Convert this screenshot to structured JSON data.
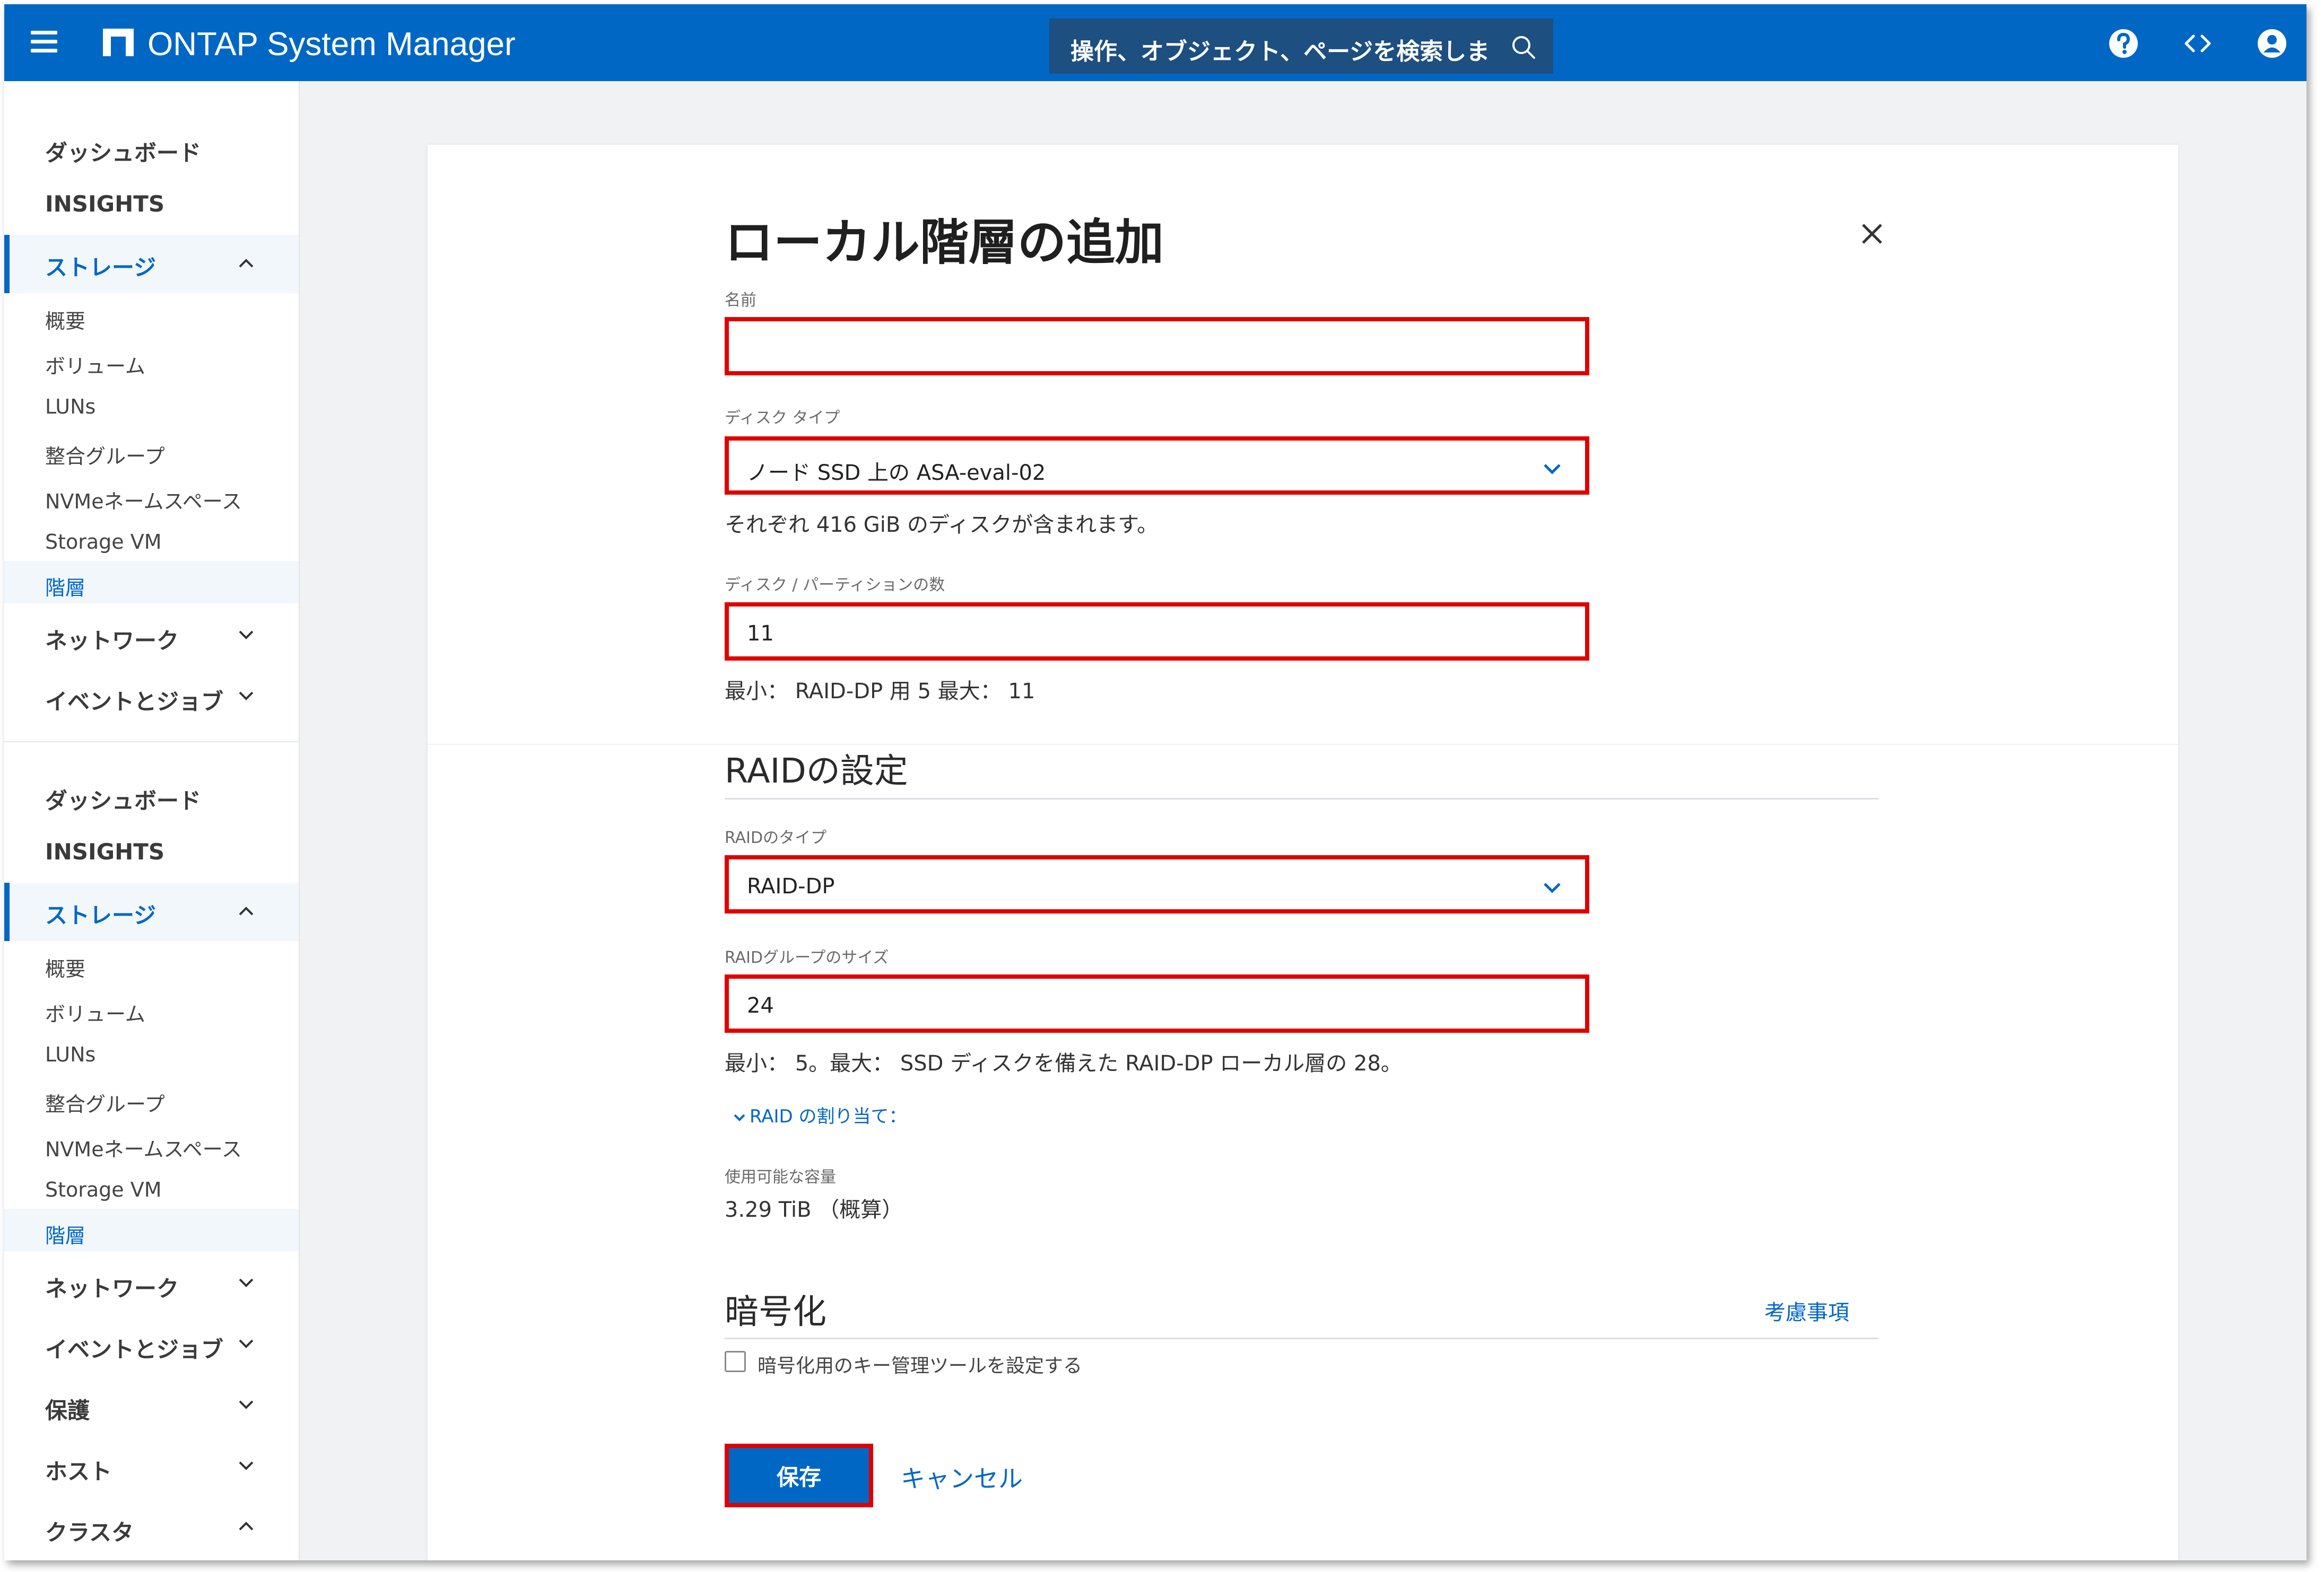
{
  "header": {
    "app_title": "ONTAP System Manager",
    "search_placeholder": "操作、オブジェクト、ページを検索しま",
    "icons": [
      "hamburger-menu-icon",
      "netapp-logo-icon",
      "search-icon",
      "help-icon",
      "code-icon",
      "user-icon"
    ],
    "color": "#0067c5"
  },
  "sidebar": {
    "groups": [
      {
        "items": [
          {
            "label": "ダッシュボード"
          },
          {
            "label": "INSIGHTS"
          },
          {
            "label": "ストレージ",
            "expanded": true
          },
          {
            "label": "概要"
          },
          {
            "label": "ボリューム"
          },
          {
            "label": "LUNs"
          },
          {
            "label": "整合グループ"
          },
          {
            "label": "NVMeネームスペース"
          },
          {
            "label": "Storage VM"
          },
          {
            "label": "階層",
            "selected": true
          },
          {
            "label": "ネットワーク"
          },
          {
            "label": "イベントとジョブ"
          }
        ]
      },
      {
        "items": [
          {
            "label": "ダッシュボード"
          },
          {
            "label": "INSIGHTS"
          },
          {
            "label": "ストレージ",
            "expanded": true
          },
          {
            "label": "概要"
          },
          {
            "label": "ボリューム"
          },
          {
            "label": "LUNs"
          },
          {
            "label": "整合グループ"
          },
          {
            "label": "NVMeネームスペース"
          },
          {
            "label": "Storage VM"
          },
          {
            "label": "階層",
            "selected": true
          },
          {
            "label": "ネットワーク"
          },
          {
            "label": "イベントとジョブ"
          },
          {
            "label": "保護"
          },
          {
            "label": "ホスト"
          },
          {
            "label": "クラスタ",
            "expanded": true
          }
        ]
      }
    ]
  },
  "dialog": {
    "title": "ローカル階層の追加",
    "name": {
      "label": "名前",
      "value": ""
    },
    "disk_type": {
      "label": "ディスク タイプ",
      "value": "ノード SSD 上の ASA-eval-02",
      "hint": "それぞれ 416 GiB のディスクが含まれます。"
    },
    "disk_count": {
      "label": "ディスク / パーティションの数",
      "value": "11",
      "hint": "最小： RAID-DP 用 5 最大： 11"
    },
    "raid_section": {
      "title": "RAIDの設定",
      "raid_type": {
        "label": "RAIDのタイプ",
        "value": "RAID-DP"
      },
      "raid_group_size": {
        "label": "RAIDグループのサイズ",
        "value": "24",
        "hint": "最小： 5。最大： SSD ディスクを備えた RAID-DP ローカル層の 28。"
      },
      "raid_allocation_link": "RAID の割り当て："
    },
    "capacity": {
      "label": "使用可能な容量",
      "value": "3.29 TiB （概算）"
    },
    "encryption": {
      "title": "暗号化",
      "considerations_link": "考慮事項",
      "checkbox_label": "暗号化用のキー管理ツールを設定する",
      "checked": false
    },
    "buttons": {
      "save": "保存",
      "cancel": "キャンセル"
    }
  }
}
